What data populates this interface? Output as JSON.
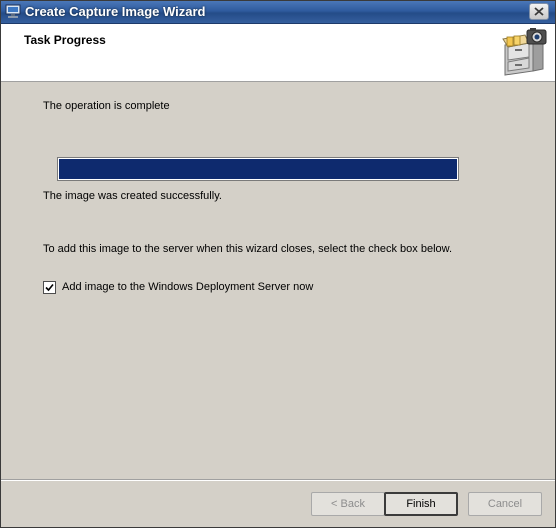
{
  "window": {
    "title": "Create Capture Image Wizard"
  },
  "header": {
    "title": "Task Progress",
    "icon": "file-cabinet-camera-icon"
  },
  "body": {
    "status_text": "The operation is complete",
    "progress": {
      "fraction": 1.0,
      "fill_color": "#0e2a6e"
    },
    "result_text": "The image was created successfully.",
    "instruction_text": "To  add this image to the server when this wizard closes, select the check box below.",
    "checkbox": {
      "label": "Add image to the Windows Deployment Server now",
      "checked": true
    }
  },
  "footer": {
    "back_label": "< Back",
    "finish_label": "Finish",
    "cancel_label": "Cancel"
  },
  "colors": {
    "titlebar": "#2f5b9e",
    "dialog_bg": "#d4d0c8",
    "header_bg": "#ffffff"
  }
}
